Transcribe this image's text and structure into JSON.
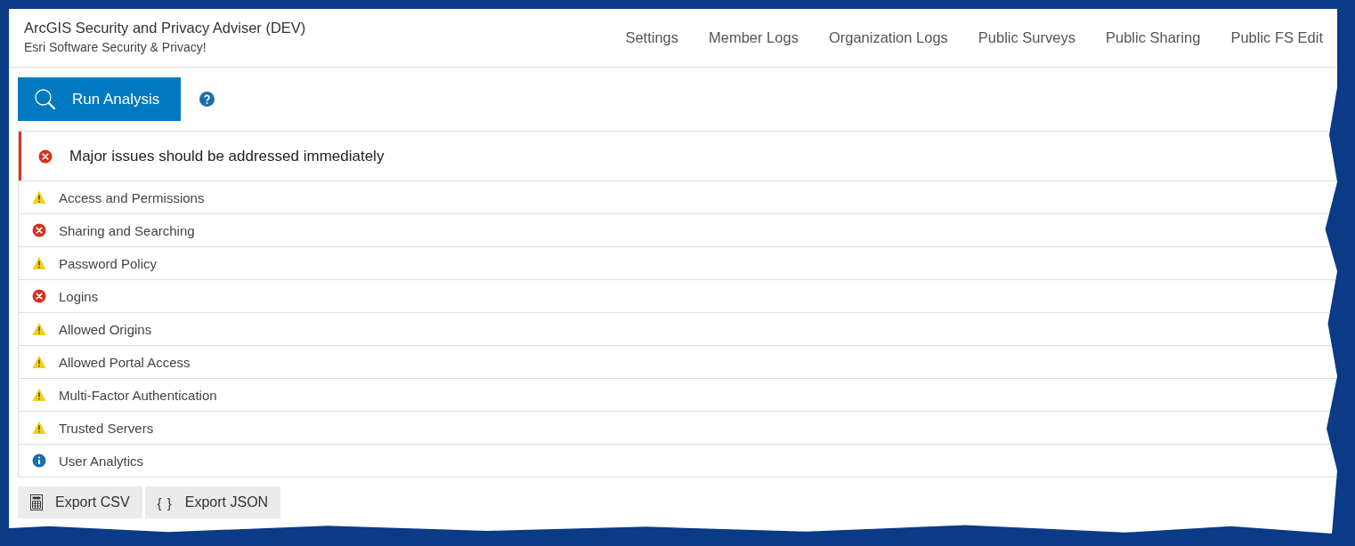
{
  "app": {
    "title": "ArcGIS Security and Privacy Adviser (DEV)",
    "subtitle": "Esri Software Security & Privacy!"
  },
  "nav": [
    {
      "label": "Settings"
    },
    {
      "label": "Member Logs"
    },
    {
      "label": "Organization Logs"
    },
    {
      "label": "Public Surveys"
    },
    {
      "label": "Public Sharing"
    },
    {
      "label": "Public FS Edit"
    }
  ],
  "toolbar": {
    "run_button": "Run Analysis"
  },
  "alert": {
    "kind": "error",
    "message": "Major issues should be addressed immediately"
  },
  "checks": [
    {
      "kind": "warning",
      "label": "Access and Permissions"
    },
    {
      "kind": "error",
      "label": "Sharing and Searching"
    },
    {
      "kind": "warning",
      "label": "Password Policy"
    },
    {
      "kind": "error",
      "label": "Logins"
    },
    {
      "kind": "warning",
      "label": "Allowed Origins"
    },
    {
      "kind": "warning",
      "label": "Allowed Portal Access"
    },
    {
      "kind": "warning",
      "label": "Multi-Factor Authentication"
    },
    {
      "kind": "warning",
      "label": "Trusted Servers"
    },
    {
      "kind": "info",
      "label": "User Analytics"
    }
  ],
  "export_buttons": [
    {
      "kind": "csv",
      "label": "Export CSV"
    },
    {
      "kind": "json",
      "icon": "{ }",
      "label": "Export JSON"
    }
  ]
}
